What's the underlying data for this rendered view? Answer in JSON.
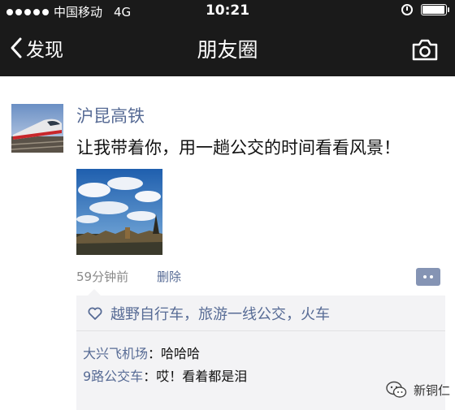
{
  "status_bar": {
    "carrier": "中国移动",
    "network": "4G",
    "time": "10:21",
    "battery_level": 0.95
  },
  "nav": {
    "back_label": "发现",
    "title": "朋友圈"
  },
  "post": {
    "username": "沪昆高铁",
    "text": "让我带着你，用一趟公交的时间看看风景！",
    "time_ago": "59分钟前",
    "delete_label": "删除",
    "likes": "越野自行车，旅游一线公交，火车",
    "comments": [
      {
        "user": "大兴飞机场",
        "sep": "：",
        "text": "哈哈哈"
      },
      {
        "user": "9路公交车",
        "sep": "：",
        "text": "哎！看着都是泪"
      }
    ]
  },
  "watermark": {
    "label": "新铜仁"
  },
  "colors": {
    "link": "#576b95",
    "bar": "#1a1a1a",
    "feedback_bg": "#f3f3f5"
  }
}
